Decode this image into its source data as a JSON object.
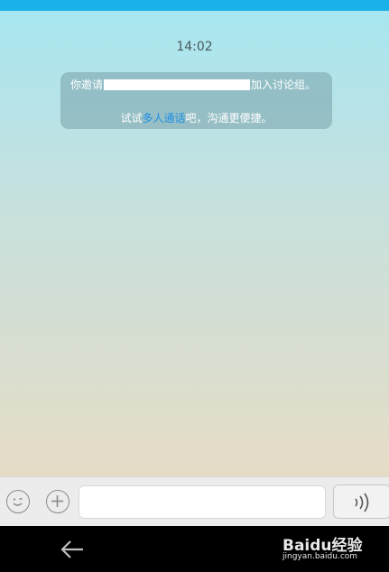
{
  "chat": {
    "timestamp": "14:02",
    "notice": {
      "prefix": "你邀请",
      "suffix": "加入讨论组。",
      "tip_before": "试试",
      "tip_link": "多人通话",
      "tip_after": "吧，沟通更便捷。"
    }
  },
  "input": {
    "value": "",
    "placeholder": ""
  },
  "icons": {
    "emoji": "emoji-icon",
    "plus": "plus-icon",
    "voice": "voice-icon",
    "back": "back-arrow-icon"
  },
  "colors": {
    "status_bar": "#1ab0e8",
    "link": "#1e90e6"
  },
  "watermark": {
    "logo": "Baidu经验",
    "url": "jingyan.baidu.com"
  }
}
